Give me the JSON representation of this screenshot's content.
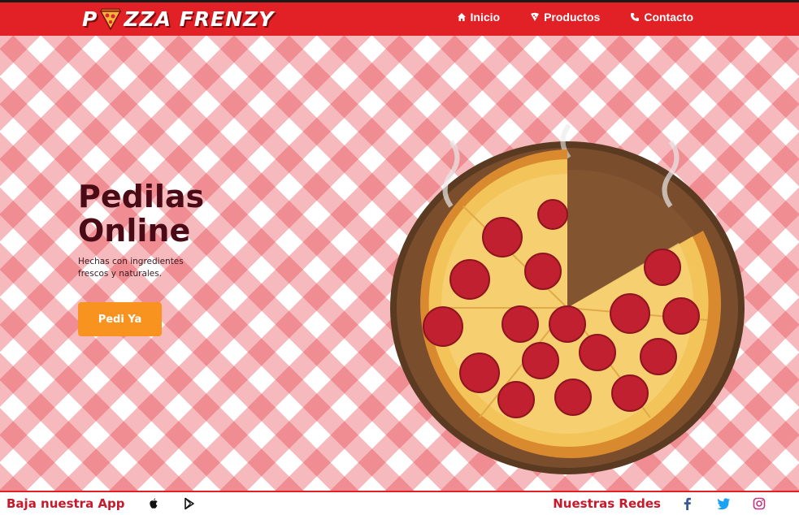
{
  "header": {
    "logo_text_left": "P",
    "logo_text_right": "ZZA FRENZY",
    "nav": [
      {
        "label": "Inicio",
        "icon": "home-icon"
      },
      {
        "label": "Productos",
        "icon": "pizza-slice-icon"
      },
      {
        "label": "Contacto",
        "icon": "phone-icon"
      }
    ]
  },
  "hero": {
    "title_line1": "Pedilas",
    "title_line2": "Online",
    "subtitle": "Hechas con ingredientes frescos y naturales.",
    "cta_label": "Pedi Ya"
  },
  "footer": {
    "app_label": "Baja nuestra App",
    "app_icons": [
      "apple-icon",
      "google-play-icon"
    ],
    "social_label": "Nuestras Redes",
    "social_icons": [
      "facebook-icon",
      "twitter-icon",
      "instagram-icon"
    ]
  },
  "colors": {
    "brand_red": "#e22127",
    "cta_orange": "#f7931e",
    "title_maroon": "#4a0b16",
    "footer_text": "#c8182a",
    "facebook_blue": "#3b5998",
    "twitter_blue": "#1da1f2",
    "instagram_pink": "#c13584"
  }
}
